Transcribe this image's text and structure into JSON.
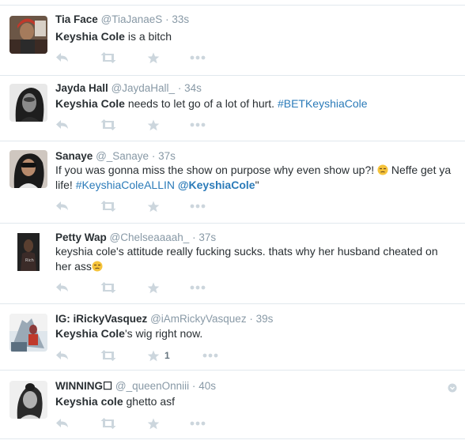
{
  "tweets": [
    {
      "name": "Tia Face",
      "handle": "@TiaJanaeS",
      "dot": "·",
      "time": "33s",
      "segments": [
        {
          "t": "Keyshia Cole",
          "s": "b"
        },
        {
          "t": " is a bitch",
          "s": ""
        }
      ],
      "retweet_count": ""
    },
    {
      "name": "Jayda Hall",
      "handle": "@JaydaHall_",
      "dot": "·",
      "time": "34s",
      "segments": [
        {
          "t": "Keyshia Cole",
          "s": "b"
        },
        {
          "t": " needs to let go of a lot of hurt. ",
          "s": ""
        },
        {
          "t": "#BETKeyshiaCole",
          "s": "link"
        }
      ],
      "retweet_count": ""
    },
    {
      "name": "Sanaye",
      "handle": "@_Sanaye",
      "dot": "·",
      "time": "37s",
      "segments": [
        {
          "t": "If you was gonna miss the show on purpose why even show up?! ",
          "s": ""
        },
        {
          "t": "unamused-emoji",
          "s": "emoji"
        },
        {
          "t": " Neffe get ya life! ",
          "s": ""
        },
        {
          "t": "#KeyshiaColeALLIN",
          "s": "link"
        },
        {
          "t": " ",
          "s": ""
        },
        {
          "t": "@KeyshiaCole",
          "s": "linkbold"
        },
        {
          "t": "\"",
          "s": ""
        }
      ],
      "retweet_count": ""
    },
    {
      "name": "Petty Wap",
      "handle": "@Chelseaaaah_",
      "dot": "·",
      "time": "37s",
      "segments": [
        {
          "t": "keyshia cole's attitude really fucking sucks. thats why her husband cheated on her ass",
          "s": ""
        },
        {
          "t": "unamused-emoji",
          "s": "emoji"
        }
      ],
      "retweet_count": ""
    },
    {
      "name": "IG: iRickyVasquez",
      "handle": "@iAmRickyVasquez",
      "dot": "·",
      "time": "39s",
      "segments": [
        {
          "t": "Keyshia Cole",
          "s": "b"
        },
        {
          "t": "'s wig right now.",
          "s": ""
        }
      ],
      "retweet_count": "1"
    },
    {
      "name": "WINNING☐",
      "handle": "@_queenOnniii",
      "dot": "·",
      "time": "40s",
      "segments": [
        {
          "t": "Keyshia cole",
          "s": "b"
        },
        {
          "t": " ghetto asf",
          "s": ""
        }
      ],
      "retweet_count": ""
    }
  ],
  "icons": {
    "reply": "reply-icon",
    "retweet": "retweet-icon",
    "favorite": "star-icon",
    "more": "more-dots-icon",
    "caret": "caret-icon"
  },
  "colors": {
    "name": "#292f33",
    "meta": "#8899a6",
    "link": "#2b7bb9",
    "action_icon": "#ccd6dd",
    "divider": "#e1e8ed"
  }
}
